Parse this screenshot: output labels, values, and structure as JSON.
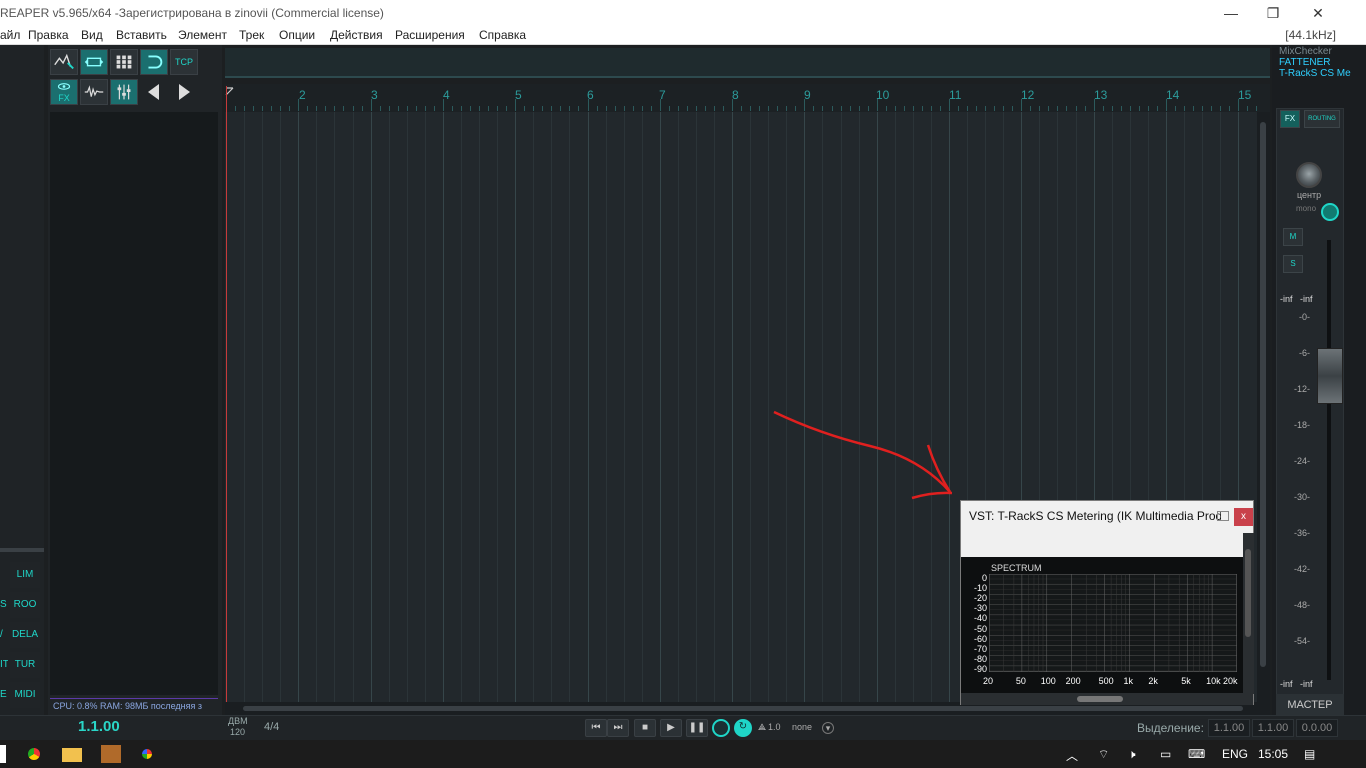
{
  "window": {
    "title": "REAPER v5.965/x64 -Зарегистрирована в zinovii (Commercial license)",
    "minimize_glyph": "—",
    "restore_glyph": "❐",
    "close_glyph": "✕"
  },
  "menu": {
    "items": [
      "айл",
      "Правка",
      "Вид",
      "Вставить",
      "Элемент",
      "Трек",
      "Опции",
      "Действия",
      "Расширения",
      "Справка"
    ],
    "sample_rate": "[44.1kHz]"
  },
  "toolbar": {
    "tcp_label": "TCP",
    "fx_label": "FX"
  },
  "left_fx_buttons": [
    {
      "prefix": "",
      "label": "LIM"
    },
    {
      "prefix": "S",
      "label": "ROO"
    },
    {
      "prefix": "/",
      "label": "DELA"
    },
    {
      "prefix": "IT",
      "label": "TUR"
    },
    {
      "prefix": "E",
      "label": "MIDI"
    }
  ],
  "status": {
    "cpu": "CPU: 0.8%  RAM: 98МБ последняя з"
  },
  "ruler": {
    "bars": [
      "2",
      "3",
      "4",
      "5",
      "6",
      "7",
      "8",
      "9",
      "10",
      "11",
      "12",
      "13",
      "14",
      "15"
    ]
  },
  "master": {
    "fx_chain": [
      "MixChecker",
      "FATTENER",
      "T-RackS CS Me"
    ],
    "fx_button": "FX",
    "routing_button": "ROUTING",
    "pan_label": "центр",
    "mono_label": "mono",
    "mute_label": "M",
    "solo_label": "S",
    "peak_left": "-inf",
    "peak_right": "-inf",
    "scale": [
      "-0-",
      "-6-",
      "-12-",
      "-18-",
      "-24-",
      "-30-",
      "-36-",
      "-42-",
      "-48-",
      "-54-"
    ],
    "bottom_left": "-inf",
    "bottom_right": "-inf",
    "label": "МАСТЕР"
  },
  "transport": {
    "position": "1.1.00",
    "bpm_label": "ДВМ",
    "bpm_value": "120",
    "time_signature": "4/4",
    "rate_text": "1.0",
    "sync_text": "none",
    "selection_label": "Выделение:",
    "selection_start": "1.1.00",
    "selection_end": "1.1.00",
    "selection_length": "0.0.00"
  },
  "vst": {
    "title": "VST: T-RackS CS Metering (IK Multimedia Produ...",
    "close_label": "x",
    "spectrum_title": "SPECTRUM",
    "y_labels": [
      "0",
      "-10",
      "-20",
      "-30",
      "-40",
      "-50",
      "-60",
      "-70",
      "-80",
      "-90"
    ],
    "x_labels": [
      "20",
      "50",
      "100",
      "200",
      "500",
      "1k",
      "2k",
      "5k",
      "10k",
      "20k"
    ]
  },
  "taskbar": {
    "language": "ENG",
    "time": "15:05"
  },
  "annotation": {
    "arrow_color": "#e0201f"
  }
}
